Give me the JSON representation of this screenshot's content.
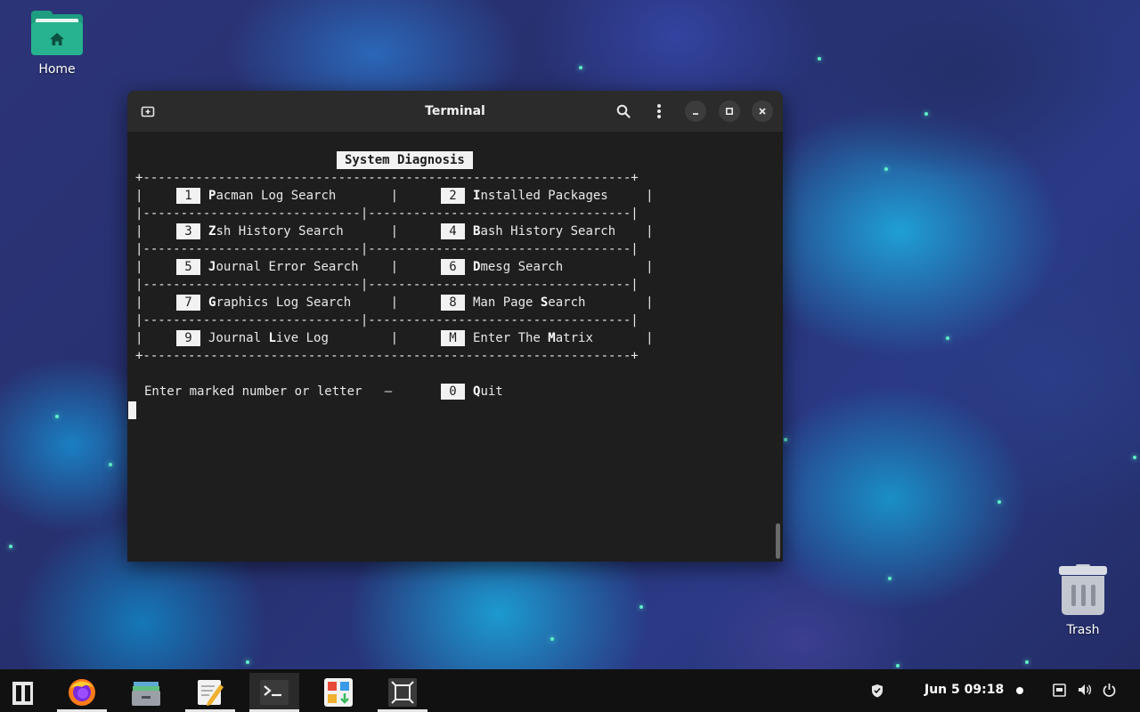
{
  "desktop": {
    "icons": [
      {
        "label": "Home"
      },
      {
        "label": "Trash"
      }
    ]
  },
  "terminal": {
    "title": "Terminal",
    "menu_header": "System Diagnosis",
    "border_top": "+-----------------------------------------------------------------+",
    "row_separator": "|-----------------------------|-----------------------------------|",
    "options": [
      {
        "key": "1",
        "hot": "P",
        "rest": "acman Log Search"
      },
      {
        "key": "2",
        "hot": "I",
        "rest": "nstalled Packages"
      },
      {
        "key": "3",
        "hot": "Z",
        "rest": "sh History Search"
      },
      {
        "key": "4",
        "hot": "B",
        "rest": "ash History Search"
      },
      {
        "key": "5",
        "hot": "J",
        "rest": "ournal Error Search"
      },
      {
        "key": "6",
        "hot": "D",
        "rest": "mesg Search"
      },
      {
        "key": "7",
        "hot": "G",
        "rest": "raphics Log Search"
      },
      {
        "key": "8",
        "pre": "Man Page ",
        "hot": "S",
        "rest": "earch"
      },
      {
        "key": "9",
        "pre": "Journal ",
        "hot": "L",
        "rest": "ive Log"
      },
      {
        "key": "M",
        "pre": "Enter The ",
        "hot": "M",
        "rest": "atrix"
      }
    ],
    "prompt": "Enter marked number or letter   –",
    "quit": {
      "key": "0",
      "hot": "Q",
      "rest": "uit"
    }
  },
  "taskbar": {
    "clock": "Jun 5  09:18",
    "apps": [
      "menu",
      "firefox",
      "files",
      "text-editor",
      "terminal",
      "software",
      "screenshot"
    ]
  },
  "colors": {
    "terminal_bg": "#1e1e1e",
    "titlebar_bg": "#2b2b2b",
    "folder_green": "#27b390",
    "taskbar_bg": "#111111"
  }
}
